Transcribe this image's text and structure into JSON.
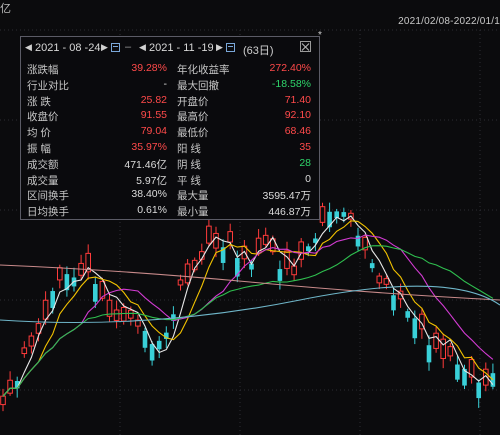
{
  "corner_label": "亿",
  "date_range": "2021/02/08-2022/01/1",
  "marker": "*",
  "panel": {
    "start_date": "2021 - 08 -24",
    "end_date": "2021 - 11 -19",
    "days": "(63日)",
    "left": [
      {
        "label": "涨跌幅",
        "value": "39.28%",
        "color": "red"
      },
      {
        "label": "行业对比",
        "value": "-",
        "color": "white"
      },
      {
        "label": "涨  跌",
        "value": "25.82",
        "color": "red"
      },
      {
        "label": "收盘价",
        "value": "91.55",
        "color": "red"
      },
      {
        "label": "均  价",
        "value": "79.04",
        "color": "red"
      },
      {
        "label": "振  幅",
        "value": "35.97%",
        "color": "red"
      },
      {
        "label": "成交额",
        "value": "471.46亿",
        "color": "white"
      },
      {
        "label": "成交量",
        "value": "5.97亿",
        "color": "white"
      },
      {
        "label": "区间换手",
        "value": "38.40%",
        "color": "white"
      },
      {
        "label": "日均换手",
        "value": "0.61%",
        "color": "white"
      }
    ],
    "right": [
      {
        "label": "年化收益率",
        "value": "272.40%",
        "color": "red"
      },
      {
        "label": "最大回撤",
        "value": "-18.58%",
        "color": "green"
      },
      {
        "label": "开盘价",
        "value": "71.40",
        "color": "red"
      },
      {
        "label": "最高价",
        "value": "92.10",
        "color": "red"
      },
      {
        "label": "最低价",
        "value": "68.46",
        "color": "red"
      },
      {
        "label": "阳  线",
        "value": "35",
        "color": "red"
      },
      {
        "label": "阴  线",
        "value": "28",
        "color": "green"
      },
      {
        "label": "平  线",
        "value": "0",
        "color": "white"
      },
      {
        "label": "最大量",
        "value": "3595.47万",
        "color": "white"
      },
      {
        "label": "最小量",
        "value": "446.87万",
        "color": "white"
      }
    ]
  },
  "colors": {
    "up": "#ff3b3b",
    "down": "#39d0d8",
    "ma5": "#e8e8e8",
    "ma10": "#f2c200",
    "ma20": "#d23bd2",
    "ma60": "#2fbf4f",
    "ma_long1": "#c98b8b",
    "ma_long2": "#6fb6c9"
  }
}
